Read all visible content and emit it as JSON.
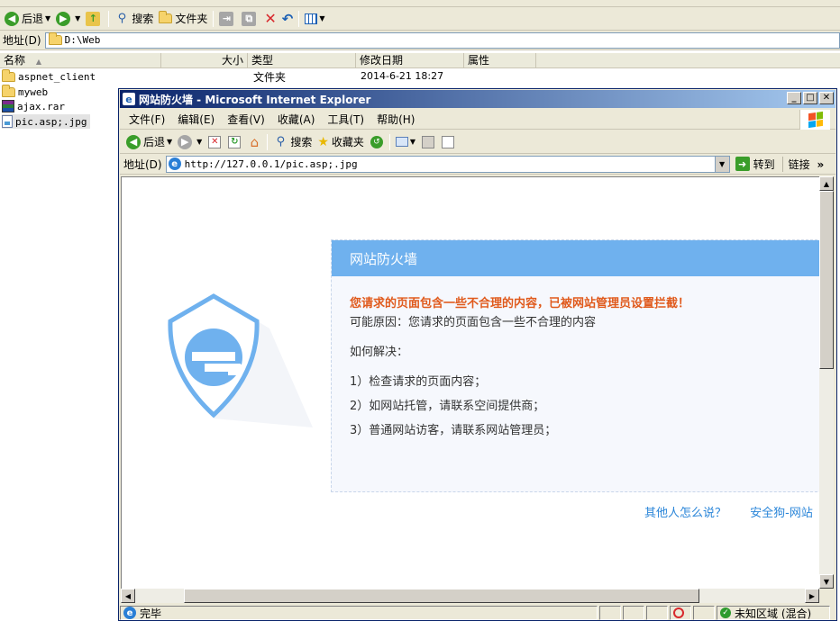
{
  "explorer": {
    "toolbar": {
      "back": "后退",
      "search": "搜索",
      "folders": "文件夹"
    },
    "address": {
      "label": "地址(D)",
      "value": "D:\\Web"
    },
    "columns": {
      "name": "名称",
      "size": "大小",
      "type": "类型",
      "modified": "修改日期",
      "attributes": "属性"
    },
    "files": [
      {
        "name": "aspnet_client",
        "type": "文件夹",
        "modified": "2014-6-21 18:27",
        "icon": "folder-icon"
      },
      {
        "name": "myweb",
        "type": "文件夹",
        "modified": "",
        "icon": "folder-icon"
      },
      {
        "name": "ajax.rar",
        "type": "",
        "modified": "",
        "icon": "rar-archive-icon"
      },
      {
        "name": "pic.asp;.jpg",
        "type": "",
        "modified": "",
        "icon": "image-file-icon"
      }
    ]
  },
  "ie": {
    "title": "网站防火墙 - Microsoft Internet Explorer",
    "menu": [
      "文件(F)",
      "编辑(E)",
      "查看(V)",
      "收藏(A)",
      "工具(T)",
      "帮助(H)"
    ],
    "toolbar": {
      "back": "后退",
      "search": "搜索",
      "favorites": "收藏夹"
    },
    "address": {
      "label": "地址(D)",
      "url": "http://127.0.0.1/pic.asp;.jpg",
      "go": "转到",
      "links": "链接"
    },
    "status": {
      "text": "完毕",
      "zone": "未知区域 (混合)"
    }
  },
  "firewall": {
    "header": "网站防火墙",
    "warning": "您请求的页面包含一些不合理的内容，已被网站管理员设置拦截！",
    "reason": "可能原因：您请求的页面包含一些不合理的内容",
    "how": "如何解决：",
    "steps": [
      "1）检查请求的页面内容；",
      "2）如网站托管，请联系空间提供商；",
      "3）普通网站访客，请联系网站管理员；"
    ],
    "links": [
      "其他人怎么说？",
      "安全狗-网站"
    ]
  },
  "colors": {
    "header_blue": "#6fb1ee",
    "warning_orange": "#e05a1c",
    "link_blue": "#2b86d9"
  }
}
